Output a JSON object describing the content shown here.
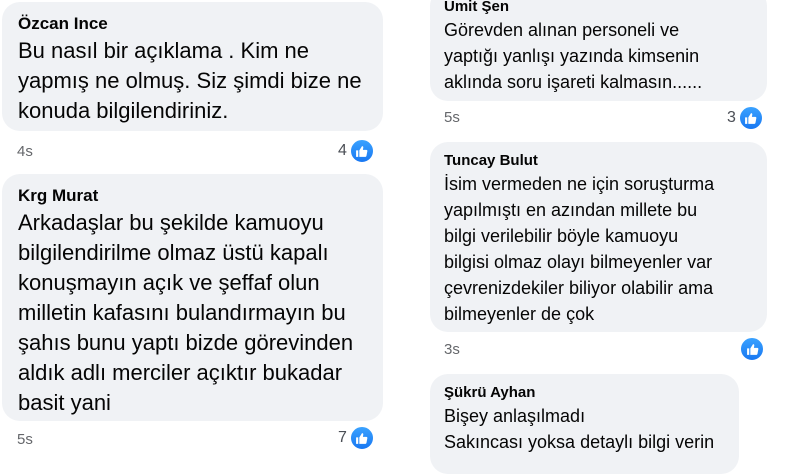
{
  "comments": [
    {
      "author": "Özcan Ince",
      "text": "Bu nasıl bir açıklama . Kim ne\nyapmış ne olmuş. Siz şimdi bize ne\nkonuda bilgilendiriniz.",
      "time": "4s",
      "reactions": "4"
    },
    {
      "author": "Krg Murat",
      "text": "Arkadaşlar bu şekilde kamuoyu\nbilgilendirilme olmaz üstü kapalı\nkonuşmayın açık ve şeffaf olun\nmilletin kafasını bulandırmayın bu\nşahıs bunu yaptı bizde görevinden\naldık adlı merciler açıktır bukadar\nbasit yani",
      "time": "5s",
      "reactions": "7"
    },
    {
      "author": "Ümit Şen",
      "text": "Görevden alınan personeli ve\nyaptığı yanlışı yazında kimsenin\naklında soru işareti kalmasın......",
      "time": "5s",
      "reactions": "3"
    },
    {
      "author": "Tuncay Bulut",
      "text": "İsim vermeden ne için soruşturma\nyapılmıştı en azından millete bu\nbilgi verilebilir böyle kamuoyu\nbilgisi olmaz olayı bilmeyenler var\nçevrenizdekiler biliyor olabilir ama\nbilmeyenler de çok",
      "time": "3s",
      "reactions": ""
    },
    {
      "author": "Şükrü Ayhan",
      "text": "Bişey anlaşılmadı\nSakıncası yoksa detaylı bilgi verin",
      "time": "",
      "reactions": ""
    }
  ],
  "reaction_icon": "like-icon",
  "colors": {
    "bubble_bg": "#f0f2f5",
    "meta_text": "#65676b",
    "like_blue": "#1877f2"
  }
}
